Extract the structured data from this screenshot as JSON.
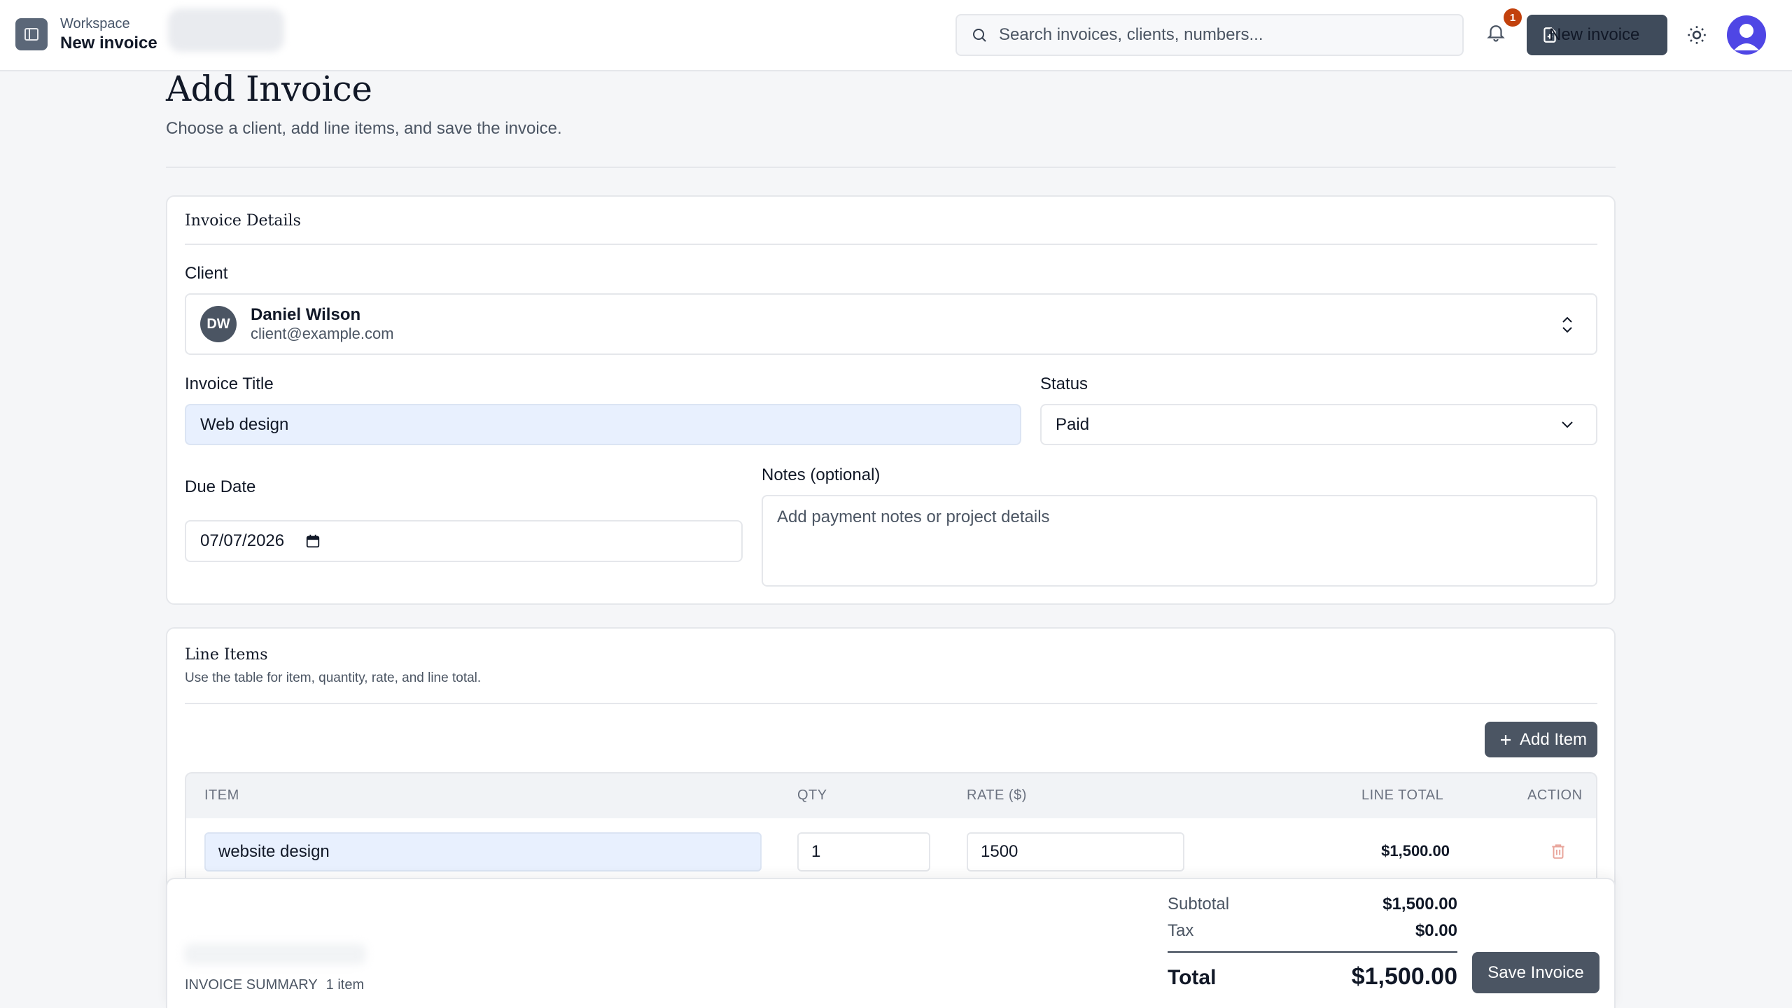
{
  "header": {
    "workspace_label": "Workspace",
    "current_page": "New invoice",
    "search_placeholder": "Search invoices, clients, numbers...",
    "notification_count": "1",
    "new_invoice_label": "New invoice"
  },
  "page": {
    "title": "Add Invoice",
    "subtitle": "Choose a client, add line items, and save the invoice."
  },
  "invoice_details": {
    "heading": "Invoice Details",
    "client_label": "Client",
    "client": {
      "initials": "DW",
      "name": "Daniel Wilson",
      "email": "client@example.com"
    },
    "title_label": "Invoice Title",
    "title_value": "Web design",
    "status_label": "Status",
    "status_value": "Paid",
    "due_label": "Due Date",
    "due_value": "07/07/2026",
    "notes_label": "Notes (optional)",
    "notes_placeholder": "Add payment notes or project details"
  },
  "line_items": {
    "heading": "Line Items",
    "description": "Use the table for item, quantity, rate, and line total.",
    "add_label": "Add Item",
    "columns": [
      "ITEM",
      "QTY",
      "RATE ($)",
      "LINE TOTAL",
      "ACTION"
    ],
    "rows": [
      {
        "item": "website design",
        "qty": "1",
        "rate": "1500",
        "line_total": "$1,500.00"
      }
    ]
  },
  "summary": {
    "label": "INVOICE SUMMARY",
    "count": "1 item",
    "subtotal_label": "Subtotal",
    "subtotal": "$1,500.00",
    "tax_label": "Tax",
    "tax": "$0.00",
    "total_label": "Total",
    "total": "$1,500.00",
    "save_label": "Save Invoice"
  },
  "colors": {
    "primary_button": "#3f4b5b",
    "badge": "#c2410c",
    "avatar": "#4f46e5",
    "filled_input": "#e8f0fe"
  }
}
